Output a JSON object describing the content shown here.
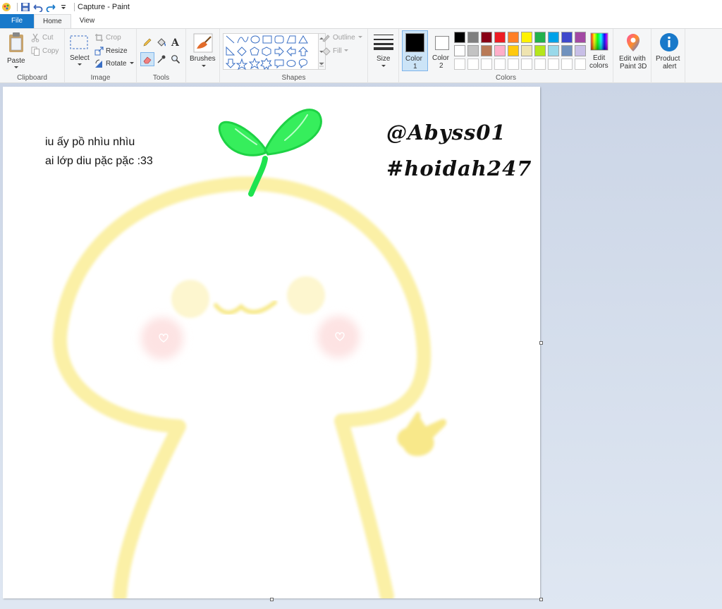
{
  "window": {
    "title": "Capture - Paint"
  },
  "tabs": [
    {
      "label": "File"
    },
    {
      "label": "Home"
    },
    {
      "label": "View"
    }
  ],
  "ribbon": {
    "clipboard": {
      "label": "Clipboard",
      "paste": "Paste",
      "cut": "Cut",
      "copy": "Copy"
    },
    "image": {
      "label": "Image",
      "select": "Select",
      "crop": "Crop",
      "resize": "Resize",
      "rotate": "Rotate"
    },
    "tools": {
      "label": "Tools"
    },
    "brushes": {
      "label": "Brushes"
    },
    "shapes": {
      "label": "Shapes",
      "outline": "Outline",
      "fill": "Fill"
    },
    "size": {
      "label": "Size"
    },
    "colors": {
      "label": "Colors",
      "color1": "Color",
      "color1_num": "1",
      "color2": "Color",
      "color2_num": "2",
      "edit": "Edit",
      "edit2": "colors",
      "palette_row1": [
        "#000000",
        "#7f7f7f",
        "#880015",
        "#ed1c24",
        "#ff7f27",
        "#fff200",
        "#22b14c",
        "#00a2e8",
        "#3f48cc",
        "#a349a4"
      ],
      "palette_row2": [
        "#ffffff",
        "#c3c3c3",
        "#b97a57",
        "#ffaec9",
        "#ffc90e",
        "#efe4b0",
        "#b5e61d",
        "#99d9ea",
        "#7092be",
        "#c8bfe7"
      ]
    },
    "paint3d": {
      "line1": "Edit with",
      "line2": "Paint 3D"
    },
    "product_alert": {
      "line1": "Product",
      "line2": "alert"
    }
  },
  "canvas": {
    "note_line1": "iu ấy pồ nhìu nhìu",
    "note_line2": "ai lớp diu pặc pặc :33",
    "signature_line1": "@Abyss01",
    "signature_line2": "#hoidah247"
  }
}
